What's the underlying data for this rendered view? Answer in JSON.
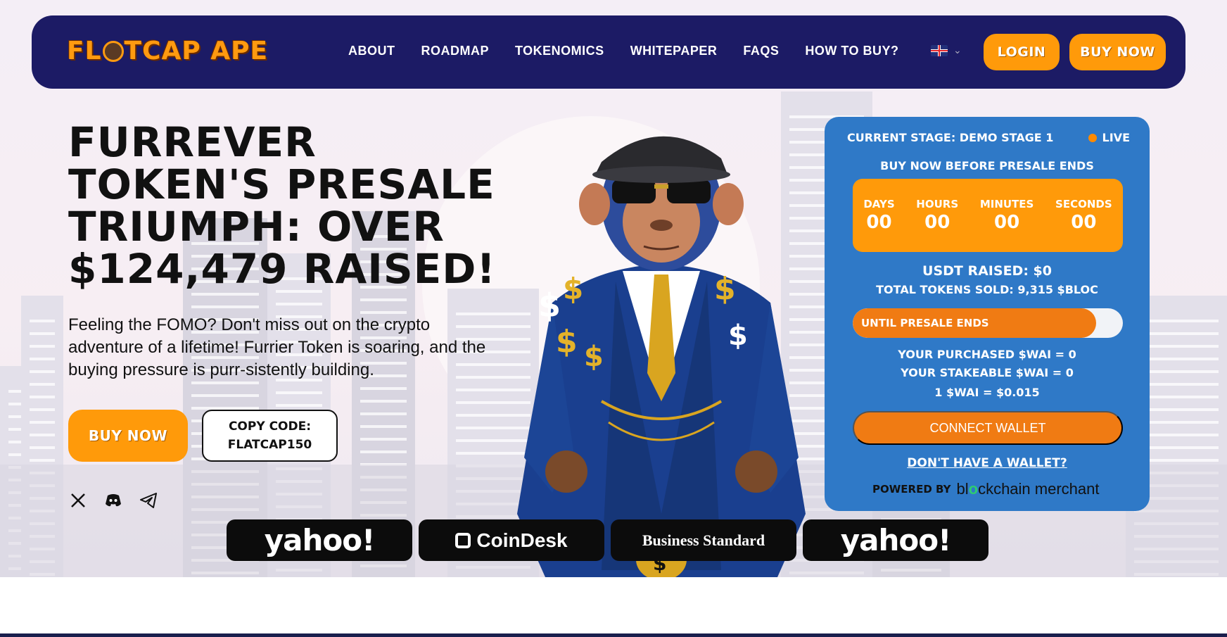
{
  "nav": {
    "logo_text": "FLATCAP APE",
    "links": [
      "ABOUT",
      "ROADMAP",
      "TOKENOMICS",
      "WHITEPAPER",
      "FAQS",
      "HOW TO BUY?"
    ],
    "login_label": "LOGIN",
    "buy_label": "BUY NOW"
  },
  "hero": {
    "headline": "FURREVER TOKEN'S PRESALE TRIUMPH: OVER $124,479 RAISED!",
    "subtext": "Feeling the FOMO? Don't miss out on the crypto adventure of a lifetime! Furrier Token is soaring, and the buying pressure is purr-sistently building.",
    "buy_label": "BUY NOW",
    "copy_label": "COPY CODE:",
    "copy_code": "FLATCAP150"
  },
  "socials": [
    "x-icon",
    "discord-icon",
    "telegram-icon"
  ],
  "presale": {
    "stage": "CURRENT STAGE: DEMO STAGE 1",
    "live": "LIVE",
    "buy_before": "BUY NOW BEFORE PRESALE ENDS",
    "countdown": [
      {
        "label": "DAYS",
        "value": "00"
      },
      {
        "label": "HOURS",
        "value": "00"
      },
      {
        "label": "MINUTES",
        "value": "00"
      },
      {
        "label": "SECONDS",
        "value": "00"
      }
    ],
    "usdt_raised": "USDT RAISED: $0",
    "tokens_sold": "TOTAL TOKENS SOLD: 9,315 $BLOC",
    "progress_label": "UNTIL PRESALE ENDS",
    "progress_pct": 90,
    "purchased": "YOUR PURCHASED $WAI = 0",
    "stakeable": "YOUR STAKEABLE $WAI = 0",
    "rate": "1 $WAI = $0.015",
    "connect_label": "CONNECT WALLET",
    "no_wallet": "DON'T HAVE A WALLET?",
    "powered_by": "POWERED BY",
    "merchant_pre": "bl",
    "merchant_mid": "o",
    "merchant_post": "ckchain merchant"
  },
  "press": [
    "yahoo!",
    "CoinDesk",
    "Business Standard",
    "yahoo!"
  ],
  "colors": {
    "nav": "#1c1b65",
    "accent": "#ff9a0a",
    "card": "#2f79c7",
    "progress": "#f07b13"
  }
}
